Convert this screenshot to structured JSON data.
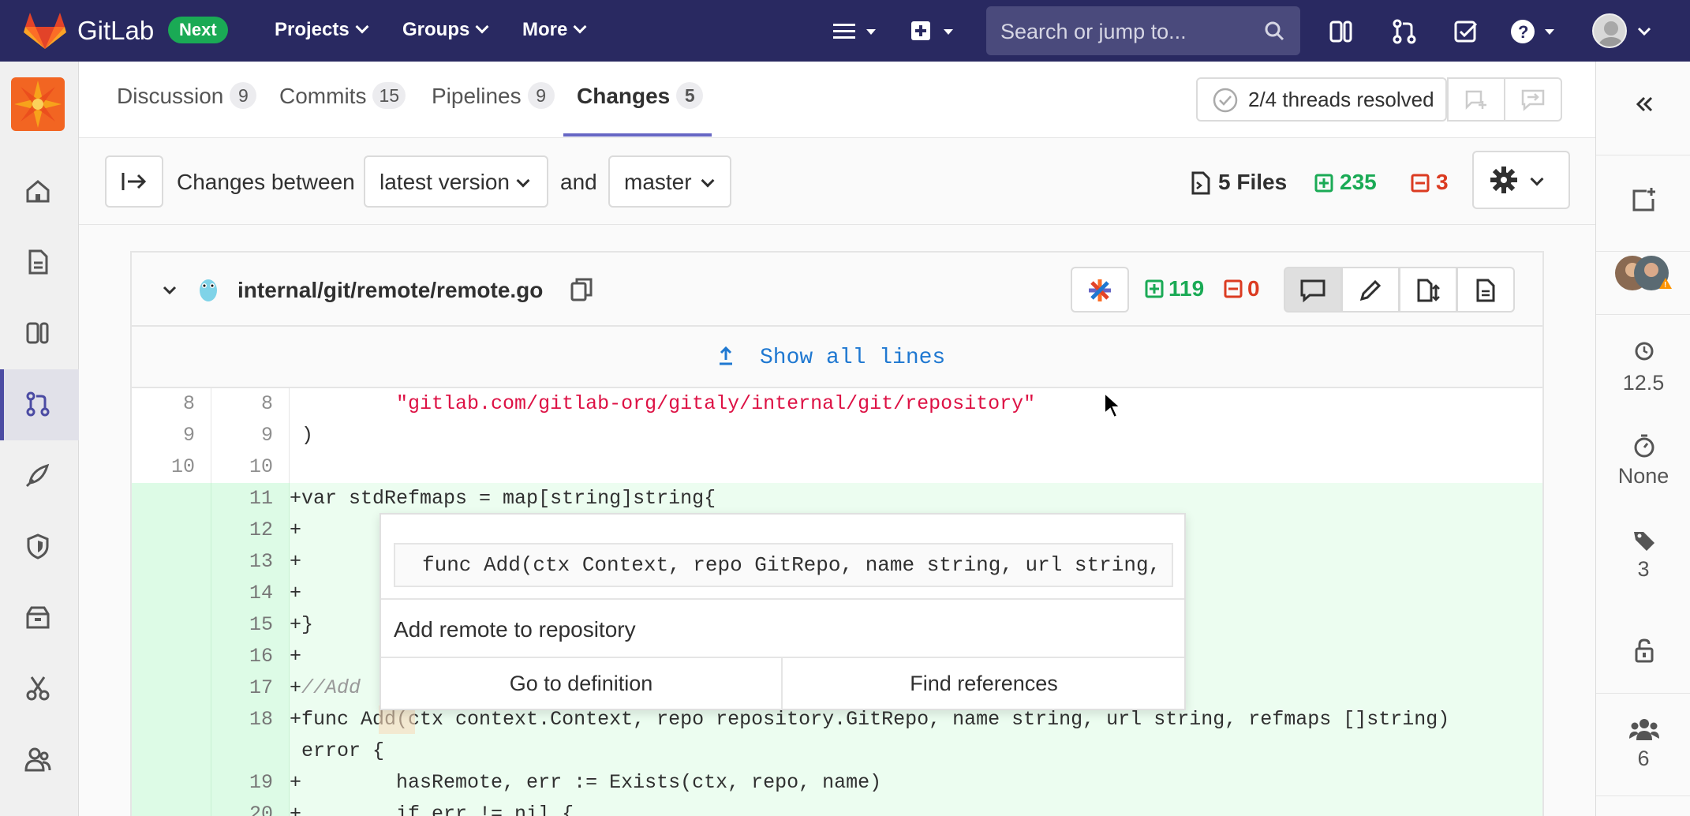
{
  "colors": {
    "navbar": "#292961",
    "accent": "#6666c4",
    "added": "#1aaa55",
    "removed": "#db3b21",
    "link": "#1f78d1"
  },
  "topnav": {
    "brand": "GitLab",
    "badge": "Next",
    "menus": [
      "Projects",
      "Groups",
      "More"
    ],
    "search_placeholder": "Search or jump to..."
  },
  "tabs": [
    {
      "label": "Discussion",
      "count": "9"
    },
    {
      "label": "Commits",
      "count": "15"
    },
    {
      "label": "Pipelines",
      "count": "9"
    },
    {
      "label": "Changes",
      "count": "5"
    }
  ],
  "threads": {
    "label": "2/4 threads resolved"
  },
  "compare": {
    "prefix": "Changes between",
    "version": "latest version",
    "and": "and",
    "target": "master",
    "files": "5 Files",
    "additions": "235",
    "deletions": "3"
  },
  "file": {
    "path": "internal/git/remote/remote.go",
    "additions": "119",
    "deletions": "0",
    "show_all": "Show all lines"
  },
  "diff_lines": [
    {
      "old": "8",
      "new": "8",
      "marker": " ",
      "text": "        \"gitlab.com/gitlab-org/gitaly/internal/git/repository\""
    },
    {
      "old": "9",
      "new": "9",
      "marker": " ",
      "text": ")"
    },
    {
      "old": "10",
      "new": "10",
      "marker": " ",
      "text": ""
    },
    {
      "old": "",
      "new": "11",
      "marker": "+",
      "text": "var stdRefmaps = map[string]string{"
    },
    {
      "old": "",
      "new": "12",
      "marker": "+",
      "text": ""
    },
    {
      "old": "",
      "new": "13",
      "marker": "+",
      "text": ""
    },
    {
      "old": "",
      "new": "14",
      "marker": "+",
      "text": ""
    },
    {
      "old": "",
      "new": "15",
      "marker": "+",
      "text": "}"
    },
    {
      "old": "",
      "new": "16",
      "marker": "+",
      "text": ""
    },
    {
      "old": "",
      "new": "17",
      "marker": "+",
      "text": "//Add"
    },
    {
      "old": "",
      "new": "18",
      "marker": "+",
      "text": "func Add(ctx context.Context, repo repository.GitRepo, name string, url string, refmaps []string)",
      "cont": " error {"
    },
    {
      "old": "",
      "new": "19",
      "marker": "+",
      "text": "        hasRemote, err := Exists(ctx, repo, name)"
    },
    {
      "old": "",
      "new": "20",
      "marker": "+",
      "text": "        if err != nil {"
    }
  ],
  "popover": {
    "signature": "func Add(ctx Context, repo GitRepo, name string, url string,",
    "description": "Add remote to repository",
    "go_to_definition": "Go to definition",
    "find_references": "Find references"
  },
  "rightbar": {
    "time_spent": "12.5",
    "estimate": "None",
    "labels": "3",
    "participants": "6"
  }
}
